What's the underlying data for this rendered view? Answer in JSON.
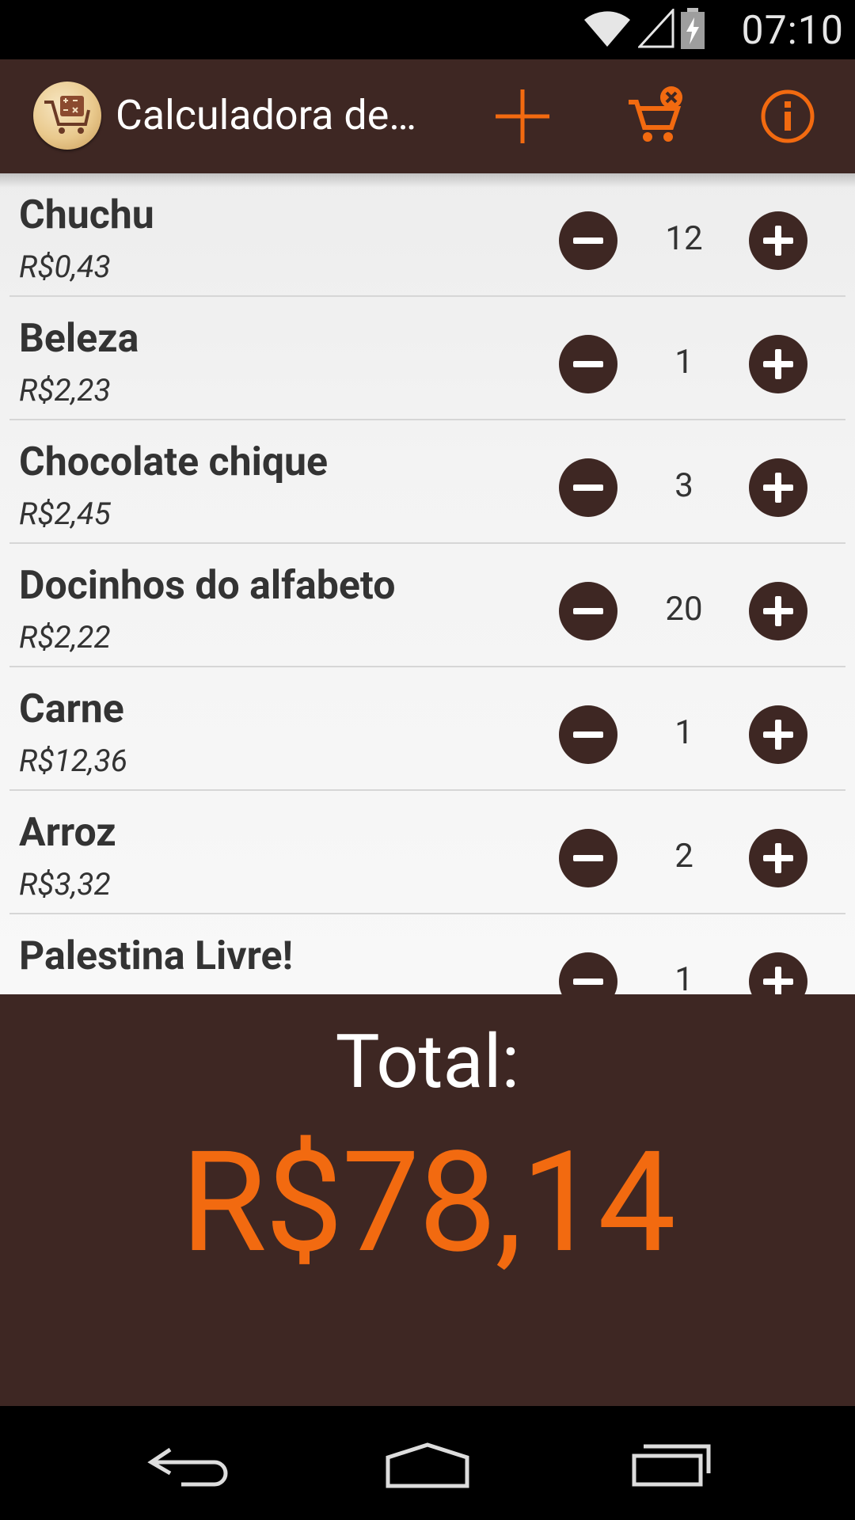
{
  "status_bar": {
    "time": "07:10"
  },
  "app_bar": {
    "title": "Calculadora de…",
    "actions": [
      "add",
      "clear-cart",
      "info"
    ]
  },
  "items": [
    {
      "name": "Chuchu",
      "price": "R$0,43",
      "qty": "12"
    },
    {
      "name": "Beleza",
      "price": "R$2,23",
      "qty": "1"
    },
    {
      "name": "Chocolate chique",
      "price": "R$2,45",
      "qty": "3"
    },
    {
      "name": "Docinhos do alfabeto",
      "price": "R$2,22",
      "qty": "20"
    },
    {
      "name": "Carne",
      "price": "R$12,36",
      "qty": "1"
    },
    {
      "name": "Arroz",
      "price": "R$3,32",
      "qty": "2"
    },
    {
      "name": "Palestina Livre!",
      "price": "",
      "qty": "1"
    }
  ],
  "total": {
    "label": "Total:",
    "value": "R$78,14"
  },
  "colors": {
    "primary": "#3e2723",
    "accent": "#f26a10",
    "list_bg": "#f3f3f3"
  }
}
